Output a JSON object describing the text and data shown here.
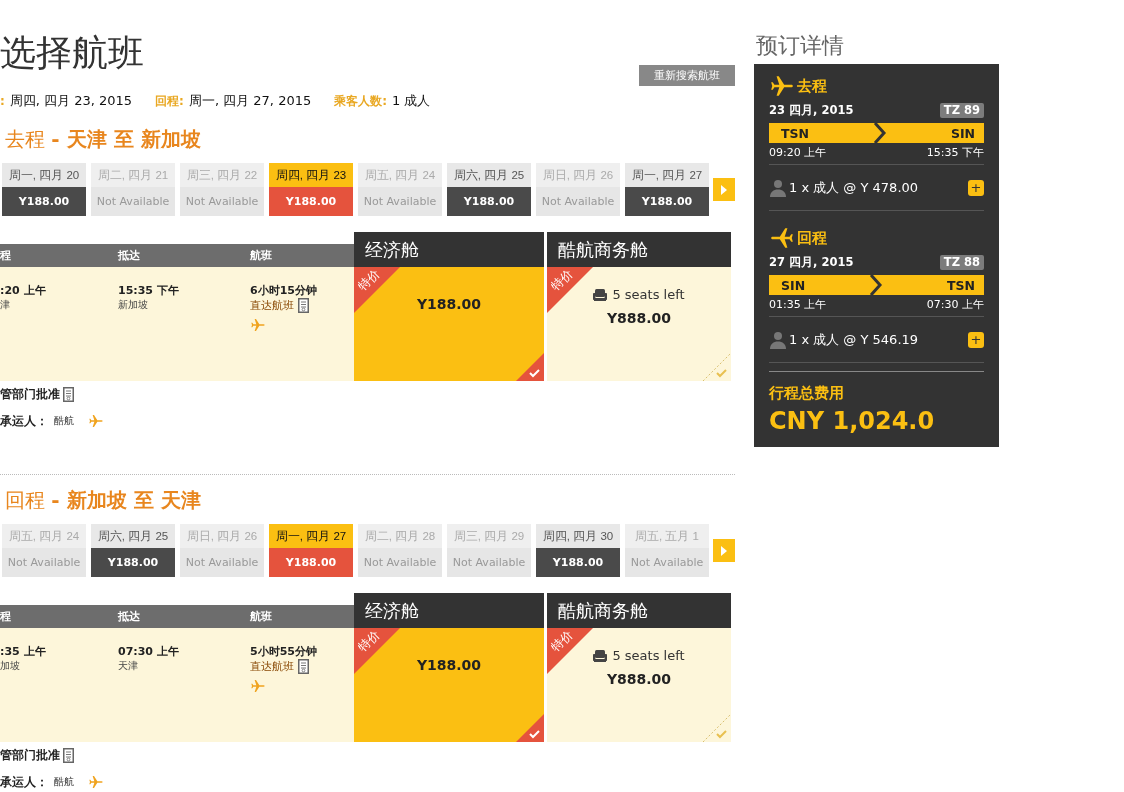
{
  "page_title": "选择航班",
  "search_again_button": "重新搜索航班",
  "trip_summary": [
    {
      "label": ":",
      "value": "周四, 四月 23, 2015"
    },
    {
      "label": "回程:",
      "value": "周一, 四月 27, 2015"
    },
    {
      "label": "乘客人数:",
      "value": "1 成人"
    }
  ],
  "legs": [
    {
      "heading": "去程 **- 天津 至 新加坡**",
      "dates": [
        {
          "day": "周一, 四月 20",
          "price": "Y188.00",
          "available": true,
          "selected": false
        },
        {
          "day": "周二, 四月 21",
          "price": "Not Available",
          "available": false,
          "selected": false
        },
        {
          "day": "周三, 四月 22",
          "price": "Not Available",
          "available": false,
          "selected": false
        },
        {
          "day": "周四, 四月 23",
          "price": "Y188.00",
          "available": true,
          "selected": true
        },
        {
          "day": "周五, 四月 24",
          "price": "Not Available",
          "available": false,
          "selected": false
        },
        {
          "day": "周六, 四月 25",
          "price": "Y188.00",
          "available": true,
          "selected": false
        },
        {
          "day": "周日, 四月 26",
          "price": "Not Available",
          "available": false,
          "selected": false
        },
        {
          "day": "周一, 四月 27",
          "price": "Y188.00",
          "available": true,
          "selected": false
        }
      ],
      "columns": [
        "程",
        "抵达",
        "航班"
      ],
      "fare_classes": [
        "经济舱",
        "酷航商务舱"
      ],
      "flight": {
        "depart_time": ":20 上午",
        "depart_city": "津",
        "arrive_time": "15:35 下午",
        "arrive_city": "新加坡",
        "duration": "6小时15分钟",
        "stops": "直达航班"
      },
      "fares": [
        {
          "deal": "特价",
          "price": "Y188.00",
          "selected": true
        },
        {
          "deal": "特价",
          "seats": "5 seats left",
          "price": "Y888.00",
          "selected": false
        }
      ],
      "approval": "管部门批准",
      "carrier_label": "承运人：",
      "carrier": "酷航"
    },
    {
      "heading": "回程 **- 新加坡 至 天津**",
      "dates": [
        {
          "day": "周五, 四月 24",
          "price": "Not Available",
          "available": false,
          "selected": false
        },
        {
          "day": "周六, 四月 25",
          "price": "Y188.00",
          "available": true,
          "selected": false
        },
        {
          "day": "周日, 四月 26",
          "price": "Not Available",
          "available": false,
          "selected": false
        },
        {
          "day": "周一, 四月 27",
          "price": "Y188.00",
          "available": true,
          "selected": true
        },
        {
          "day": "周二, 四月 28",
          "price": "Not Available",
          "available": false,
          "selected": false
        },
        {
          "day": "周三, 四月 29",
          "price": "Not Available",
          "available": false,
          "selected": false
        },
        {
          "day": "周四, 四月 30",
          "price": "Y188.00",
          "available": true,
          "selected": false
        },
        {
          "day": "周五, 五月 1",
          "price": "Not Available",
          "available": false,
          "selected": false
        }
      ],
      "columns": [
        "程",
        "抵达",
        "航班"
      ],
      "fare_classes": [
        "经济舱",
        "酷航商务舱"
      ],
      "flight": {
        "depart_time": ":35 上午",
        "depart_city": "加坡",
        "arrive_time": "07:30 上午",
        "arrive_city": "天津",
        "duration": "5小时55分钟",
        "stops": "直达航班"
      },
      "fares": [
        {
          "deal": "特价",
          "price": "Y188.00",
          "selected": true
        },
        {
          "deal": "特价",
          "seats": "5 seats left",
          "price": "Y888.00",
          "selected": false
        }
      ],
      "approval": "管部门批准",
      "carrier_label": "承运人：",
      "carrier": "酷航"
    }
  ],
  "booking": {
    "title": "预订详情",
    "legs": [
      {
        "kind": "outbound",
        "label": "去程",
        "date": "23 四月, 2015",
        "flight_number": "TZ 89",
        "from": "TSN",
        "to": "SIN",
        "depart": "09:20 上午",
        "arrive": "15:35 下午",
        "fare": "1 x 成人 @ Y 478.00",
        "expand": "+"
      },
      {
        "kind": "return",
        "label": "回程",
        "date": "27 四月, 2015",
        "flight_number": "TZ 88",
        "from": "SIN",
        "to": "TSN",
        "depart": "01:35 上午",
        "arrive": "07:30 上午",
        "fare": "1 x 成人 @ Y 546.19",
        "expand": "+"
      }
    ],
    "total_label": "行程总费用",
    "total": "CNY 1,024.0"
  }
}
